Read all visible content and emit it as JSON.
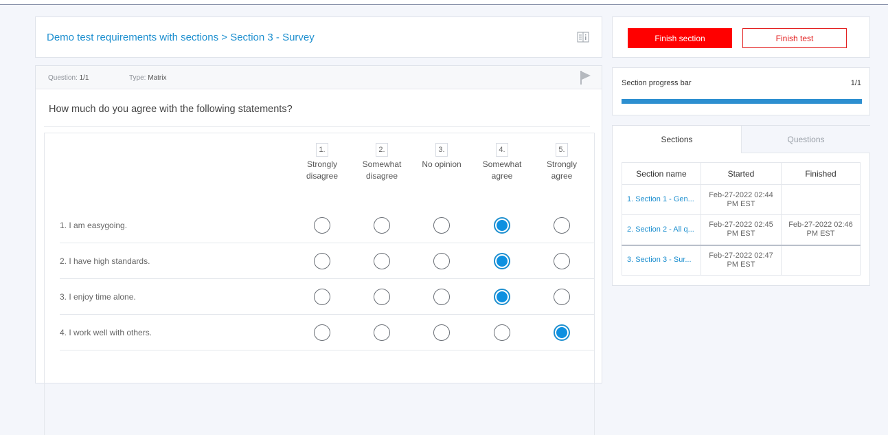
{
  "header": {
    "title": "Demo test requirements with sections > Section 3 - Survey"
  },
  "question": {
    "number_label": "Question:",
    "number_value": "1/1",
    "type_label": "Type:",
    "type_value": "Matrix",
    "text": "How much do you agree with the following statements?",
    "columns": [
      {
        "num": "1.",
        "label": "Strongly disagree"
      },
      {
        "num": "2.",
        "label": "Somewhat disagree"
      },
      {
        "num": "3.",
        "label": "No opinion"
      },
      {
        "num": "4.",
        "label": "Somewhat agree"
      },
      {
        "num": "5.",
        "label": "Strongly agree"
      }
    ],
    "rows": [
      {
        "label": "1.  I am easygoing.",
        "selected": 4
      },
      {
        "label": "2.  I have high standards.",
        "selected": 4
      },
      {
        "label": "3.  I enjoy time alone.",
        "selected": 4
      },
      {
        "label": "4.  I work well with others.",
        "selected": 5
      }
    ]
  },
  "actions": {
    "finish_section": "Finish section",
    "finish_test": "Finish test"
  },
  "progress": {
    "label": "Section progress bar",
    "count": "1/1",
    "fraction": 1.0
  },
  "panel": {
    "tabs": [
      "Sections",
      "Questions"
    ],
    "active_tab": "Sections",
    "headers": [
      "Section name",
      "Started",
      "Finished"
    ],
    "rows": [
      {
        "name": "1. Section 1 - Gen...",
        "started": "Feb-27-2022 02:44 PM EST",
        "finished": ""
      },
      {
        "name": "2. Section 2 - All q...",
        "started": "Feb-27-2022 02:45 PM EST",
        "finished": "Feb-27-2022 02:46 PM EST"
      },
      {
        "name": "3. Section 3 - Sur...",
        "started": "Feb-27-2022 02:47 PM EST",
        "finished": ""
      }
    ]
  },
  "colors": {
    "accent": "#1d8fcf",
    "danger": "#ff0000",
    "radio_fill": "#0e90e0",
    "progress": "#2d8fd0"
  }
}
